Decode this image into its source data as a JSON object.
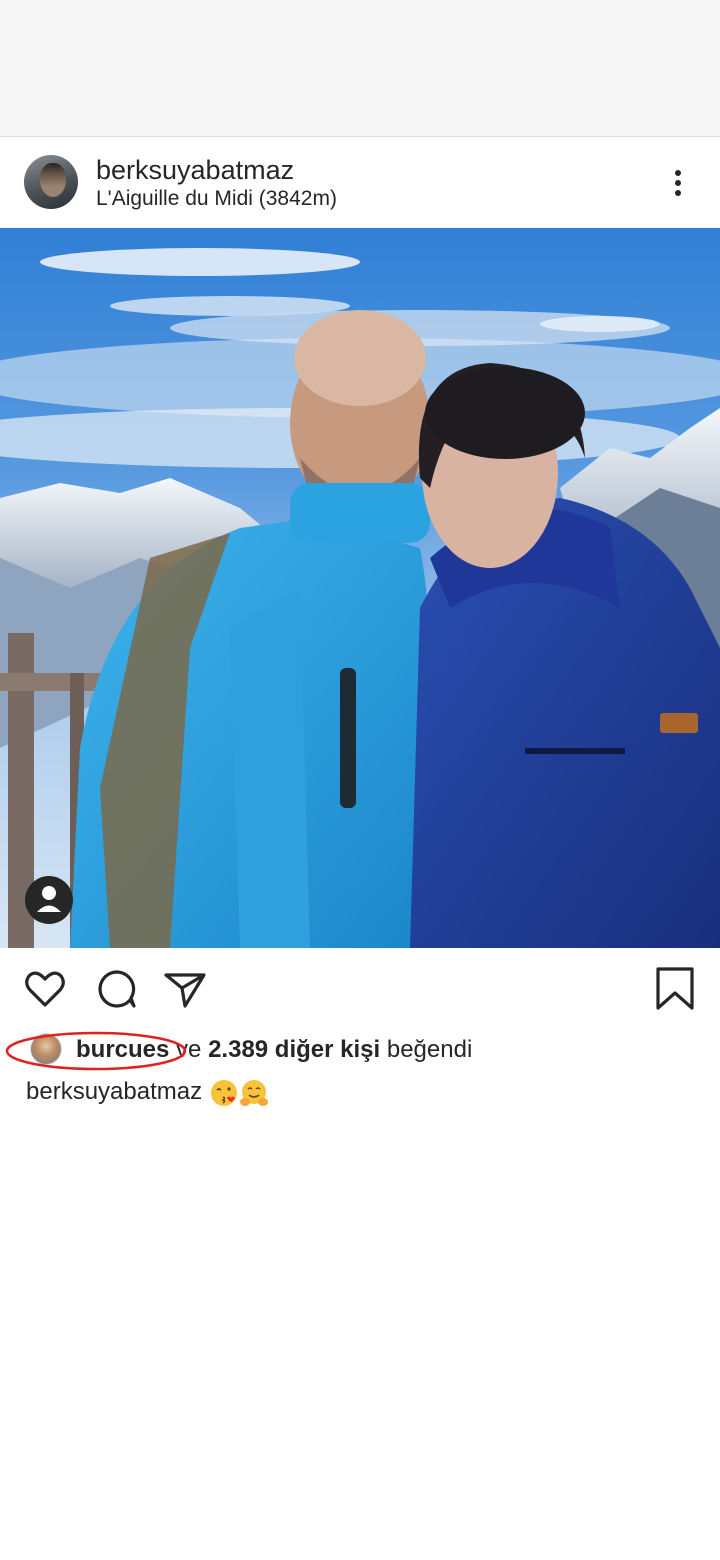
{
  "post": {
    "username": "berksuyabatmaz",
    "location": "L'Aiguille du Midi (3842m)"
  },
  "actions": {
    "like": "heart-icon",
    "comment": "comment-icon",
    "share": "send-icon",
    "save": "bookmark-icon"
  },
  "likes": {
    "liker": "burcues",
    "connector": "ve",
    "count_text": "2.389 diğer kişi",
    "suffix": "beğendi"
  },
  "caption": {
    "username": "berksuyabatmaz",
    "emojis": [
      "kissing-face-emoji",
      "hugging-face-emoji"
    ]
  },
  "colors": {
    "highlight": "#e0211f",
    "text": "#262626",
    "jacket_left": "#2da5e0",
    "jacket_right": "#1f3f99"
  }
}
